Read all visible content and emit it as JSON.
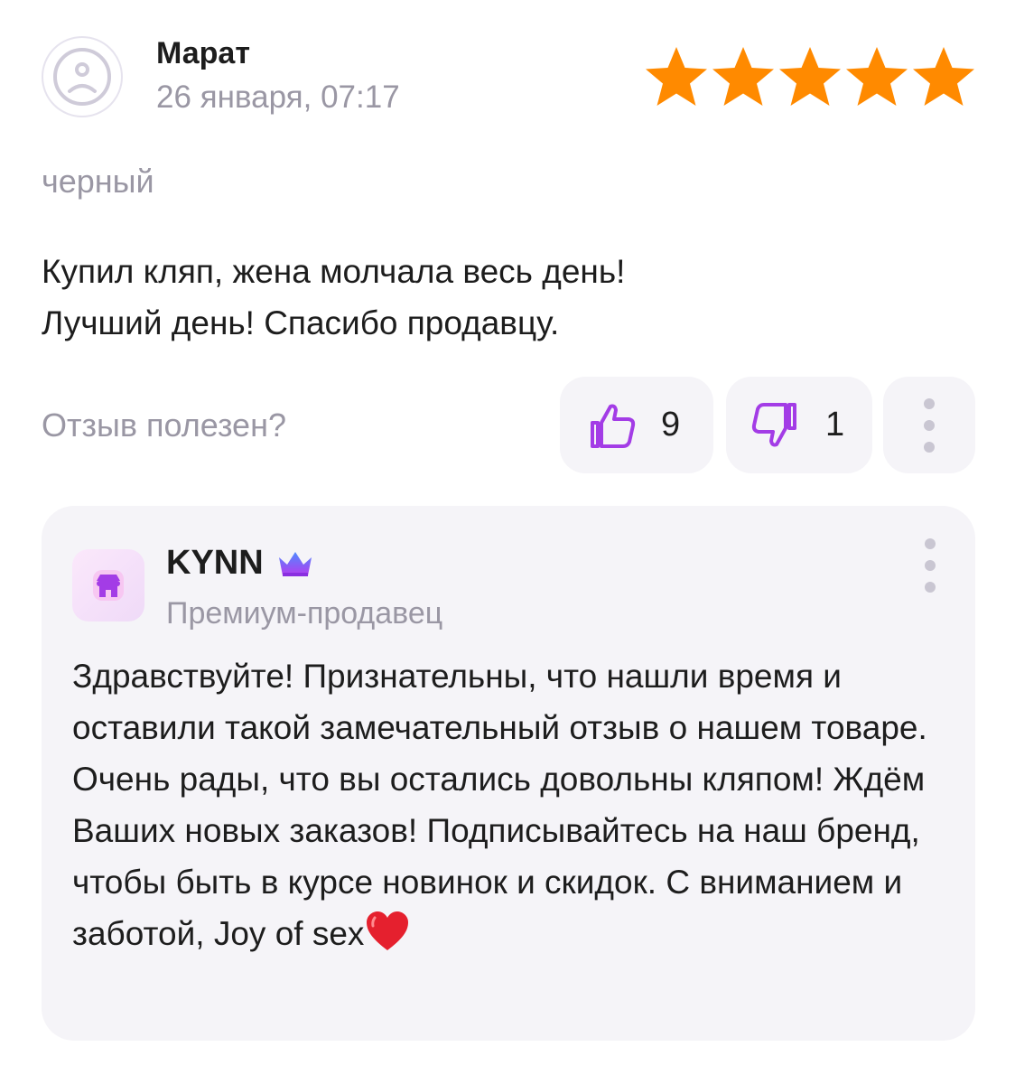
{
  "review": {
    "author": "Марат",
    "date": "26 января, 07:17",
    "rating": 5,
    "variant": "черный",
    "text_lines": [
      "Купил кляп, жена молчала весь день!",
      "Лучший день! Спасибо продавцу."
    ],
    "helpful_question": "Отзыв полезен?",
    "likes": "9",
    "dislikes": "1"
  },
  "reply": {
    "seller_name": "KYNN",
    "seller_badge": "Премиум-продавец",
    "text": "Здравствуйте! Признательны, что нашли время и оставили такой замечательный отзыв о нашем товаре. Очень рады, что вы остались довольны кляпом! Ждём Ваших новых заказов! Подписывайтесь на наш бренд, чтобы быть в курсе новинок и скидок. С вниманием и заботой, Joy of sex",
    "end_emoji": "heart-icon"
  },
  "colors": {
    "star": "#ff8a00",
    "accent": "#a33ce6",
    "muted": "#9a97a4",
    "button_bg": "#f5f4f8"
  },
  "icons": {
    "avatar": "sad-face-icon",
    "like": "thumbs-up-icon",
    "dislike": "thumbs-down-icon",
    "more": "more-vertical-icon",
    "seller_logo": "store-icon",
    "premium": "crown-icon"
  }
}
